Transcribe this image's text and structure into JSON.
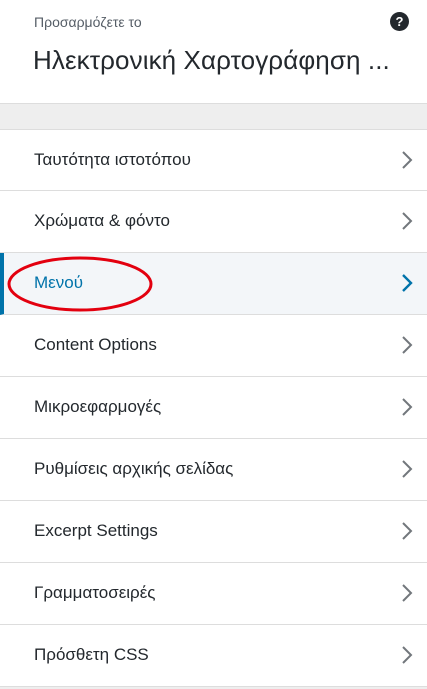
{
  "header": {
    "caption": "Προσαρμόζετε το",
    "title": "Ηλεκτρονική Χαρτογράφηση ...",
    "help_symbol": "?"
  },
  "panels": [
    {
      "label": "Ταυτότητα ιστοτόπου",
      "active": false
    },
    {
      "label": "Χρώματα & φόντο",
      "active": false
    },
    {
      "label": "Μενού",
      "active": true
    },
    {
      "label": "Content Options",
      "active": false
    },
    {
      "label": "Μικροεφαρμογές",
      "active": false
    },
    {
      "label": "Ρυθμίσεις αρχικής σελίδας",
      "active": false
    },
    {
      "label": "Excerpt Settings",
      "active": false
    },
    {
      "label": "Γραμματοσειρές",
      "active": false
    },
    {
      "label": "Πρόσθετη CSS",
      "active": false
    }
  ],
  "colors": {
    "accent": "#0073aa",
    "annotation": "#e3000f",
    "text": "#23282d",
    "muted": "#555d66"
  },
  "icons": {
    "help": "help-icon",
    "chevron": "chevron-right-icon",
    "annotation": "red-circle-annotation"
  }
}
